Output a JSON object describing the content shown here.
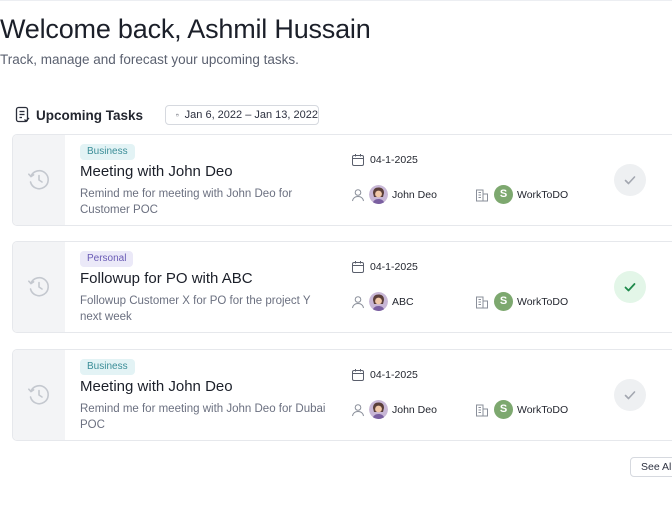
{
  "header": {
    "title": "Welcome back, Ashmil Hussain",
    "subtitle": "Track, manage and forecast your upcoming tasks."
  },
  "upcoming": {
    "section_title": "Upcoming Tasks",
    "section_icon": "task-list-icon",
    "date_range": "Jan 6, 2022 – Jan 13, 2022",
    "see_all_label": "See All"
  },
  "colors": {
    "business_tag_bg": "#e3f3f5",
    "personal_tag_bg": "#ebe9f8",
    "workspace_badge": "#7da86f",
    "done_toggle_bg": "#e3f6e8",
    "done_check": "#1f8a4c"
  },
  "tasks": [
    {
      "tag": "Business",
      "title": "Meeting with  John Deo",
      "description": "Remind me for meeting with John Deo for Customer POC",
      "date": "04-1-2025",
      "assignee": "John Deo",
      "workspace_initial": "S",
      "workspace": "WorkToDO",
      "completed": false
    },
    {
      "tag": "Personal",
      "title": "Followup for PO with  ABC",
      "description": "Followup Customer X for PO for the project Y next week",
      "date": "04-1-2025",
      "assignee": "ABC",
      "workspace_initial": "S",
      "workspace": "WorkToDO",
      "completed": true
    },
    {
      "tag": "Business",
      "title": "Meeting with  John Deo",
      "description": "Remind me for meeting with John Deo for Dubai POC",
      "date": "04-1-2025",
      "assignee": "John Deo",
      "workspace_initial": "S",
      "workspace": "WorkToDO",
      "completed": false
    }
  ]
}
